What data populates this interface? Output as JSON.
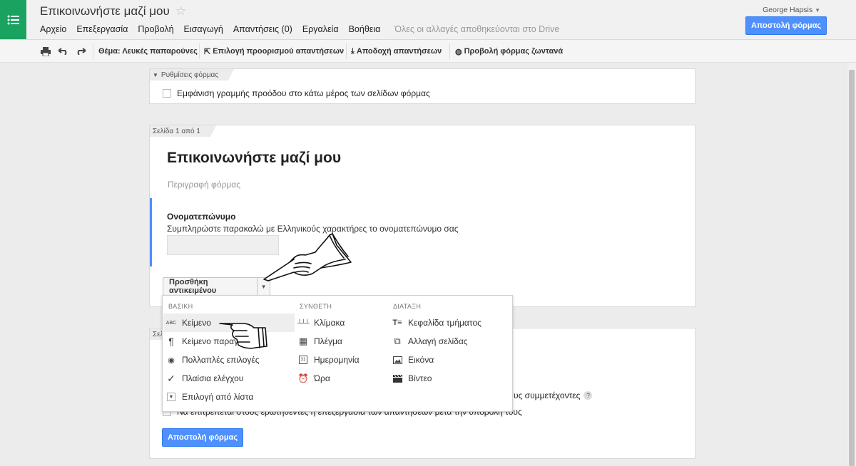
{
  "header": {
    "doc_title": "Επικοινωνήστε μαζί μου",
    "user": "George Hapsis",
    "send_button": "Αποστολή φόρμας",
    "menu": [
      "Αρχείο",
      "Επεξεργασία",
      "Προβολή",
      "Εισαγωγή",
      "Απαντήσεις (0)",
      "Εργαλεία",
      "Βοήθεια"
    ],
    "save_status": "Όλες οι αλλαγές αποθηκεύονται στο Drive"
  },
  "toolbar": {
    "theme": "Θέμα: Λευκές παπαρούνες",
    "destination": "Επιλογή προορισμού απαντήσεων",
    "accepting": "Αποδοχή απαντήσεων",
    "view_live": "Προβολή φόρμας ζωντανά"
  },
  "settings": {
    "tag": "Ρυθμίσεις φόρμας",
    "progress_label": "Εμφάνιση γραμμής προόδου στο κάτω μέρος των σελίδων φόρμας"
  },
  "page": {
    "tag": "Σελίδα 1 από 1",
    "title": "Επικοινωνήστε μαζί μου",
    "description_placeholder": "Περιγραφή φόρμας",
    "question_title": "Ονοματεπώνυμο",
    "question_help": "Συμπληρώστε παρακαλώ με Ελληνικούς χαρακτήρες το ονοματεπώνυμο σας",
    "add_item_button": "Προσθήκη αντικειμένου"
  },
  "add_menu": {
    "basic_heading": "ΒΑΣΙΚΗ",
    "advanced_heading": "ΣΥΝΘΕΤΗ",
    "layout_heading": "ΔΙΑΤΑΞΗ",
    "basic": [
      {
        "label": "Κείμενο",
        "icon": "abc-text-icon"
      },
      {
        "label": "Κείμενο παραγράφου",
        "icon": "paragraph-icon"
      },
      {
        "label": "Πολλαπλές επιλογές",
        "icon": "radio-icon"
      },
      {
        "label": "Πλαίσια ελέγχου",
        "icon": "checkmark-icon"
      },
      {
        "label": "Επιλογή από λίστα",
        "icon": "dropdown-icon"
      }
    ],
    "advanced": [
      {
        "label": "Κλίμακα",
        "icon": "scale-icon"
      },
      {
        "label": "Πλέγμα",
        "icon": "grid-icon"
      },
      {
        "label": "Ημερομηνία",
        "icon": "calendar-icon"
      },
      {
        "label": "Ώρα",
        "icon": "clock-icon"
      }
    ],
    "layout": [
      {
        "label": "Κεφαλίδα τμήματος",
        "icon": "section-header-icon"
      },
      {
        "label": "Αλλαγή σελίδας",
        "icon": "page-break-icon"
      },
      {
        "label": "Εικόνα",
        "icon": "image-icon"
      },
      {
        "label": "Βίντεο",
        "icon": "video-icon"
      }
    ]
  },
  "confirmation": {
    "tag_partial": "Σελ",
    "respondents_text": "υς συμμετέχοντες",
    "edit_option": "Να επιτρέπεται στους ερωτηθέντες η επεξεργασία των απαντήσεών μετά την υποβολή τους",
    "send_button": "Αποστολή φόρμας"
  },
  "colors": {
    "accent_blue": "#4d90fe",
    "app_green": "#1aa260"
  }
}
